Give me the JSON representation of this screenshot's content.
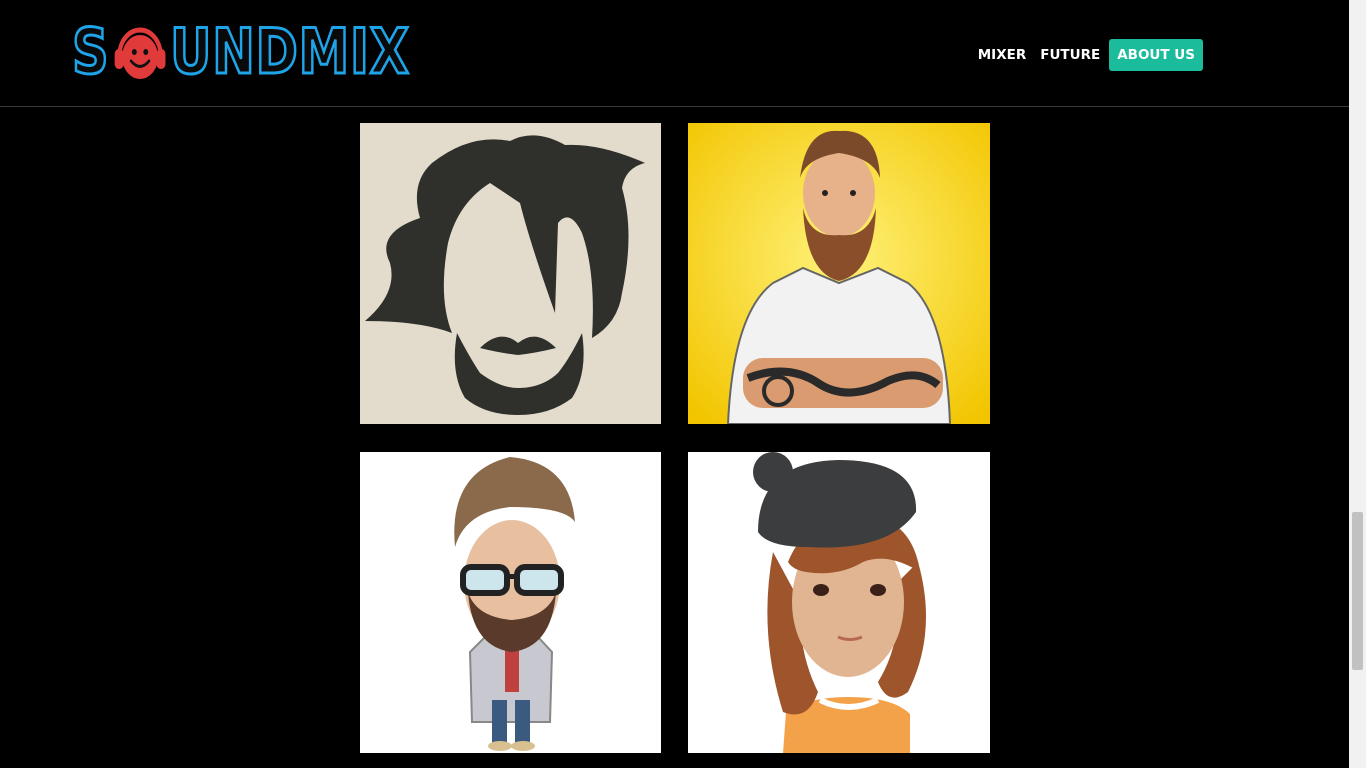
{
  "brand": {
    "name": "SOUNDMIX",
    "prefix": "S",
    "suffix": "UNDMIX",
    "accent": "#1ea4e8",
    "smiley_color": "#e03a3a"
  },
  "nav": {
    "items": [
      {
        "label": "MIXER",
        "active": false
      },
      {
        "label": "FUTURE",
        "active": false
      },
      {
        "label": "ABOUT US",
        "active": true
      }
    ],
    "active_color": "#1abc9c"
  },
  "gallery": {
    "avatars": [
      {
        "icon": "hair-beard-silhouette-icon"
      },
      {
        "icon": "bearded-tattooed-man-icon"
      },
      {
        "icon": "hipster-glasses-man-icon"
      },
      {
        "icon": "woman-beret-icon"
      }
    ]
  },
  "scrollbar": {
    "position": 0.67
  }
}
